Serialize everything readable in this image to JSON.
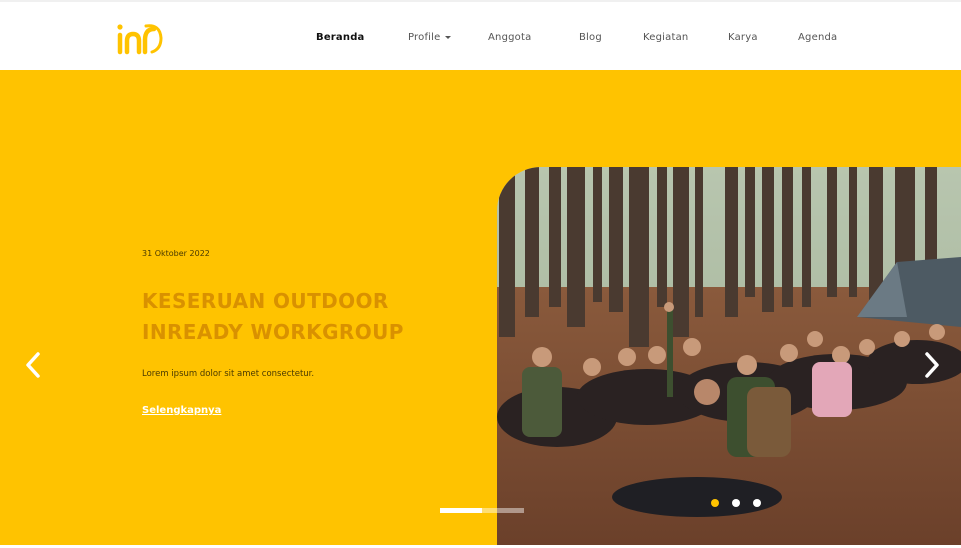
{
  "nav": {
    "logo_text": "inr",
    "items": [
      {
        "label": "Beranda",
        "active": true
      },
      {
        "label": "Profile",
        "dropdown": true
      },
      {
        "label": "Anggota"
      },
      {
        "label": "Blog"
      },
      {
        "label": "Kegiatan"
      },
      {
        "label": "Karya"
      },
      {
        "label": "Agenda"
      }
    ]
  },
  "hero": {
    "date": "31 Oktober 2022",
    "title_line1": "KESERUAN OUTDOOR",
    "title_line2": "INREADY WORKGROUP",
    "description": "Lorem ipsum dolor sit amet consectetur.",
    "link_label": "Selengkapnya",
    "image_description": "Group photo of participants sitting in a pine forest",
    "slide_progress": 0.5,
    "active_dot": 0,
    "dot_count": 3
  },
  "colors": {
    "brand_yellow": "#FFC300",
    "title_orange": "#D99100",
    "text_dark": "#4a3a00",
    "nav_text": "#555555"
  },
  "icons": {
    "prev": "chevron-left-icon",
    "next": "chevron-right-icon"
  }
}
